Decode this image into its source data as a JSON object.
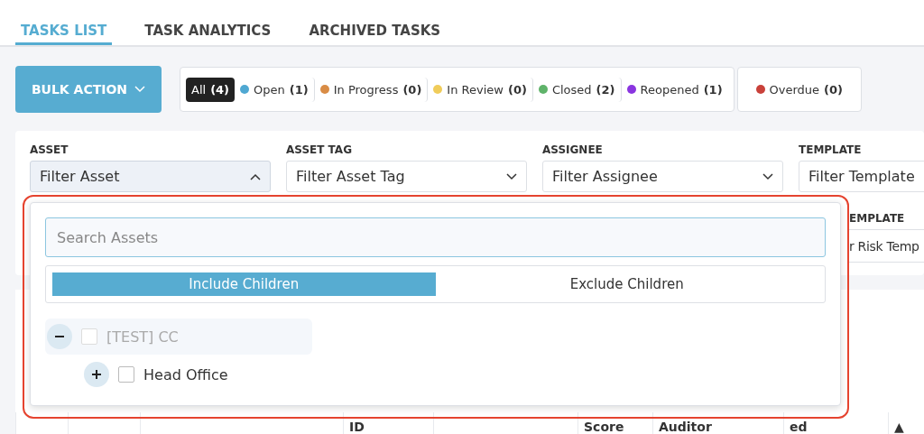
{
  "tabs": [
    {
      "label": "TASKS LIST",
      "selected": true
    },
    {
      "label": "TASK ANALYTICS",
      "selected": false
    },
    {
      "label": "ARCHIVED TASKS",
      "selected": false
    }
  ],
  "bulk_action": {
    "label": "BULK ACTION"
  },
  "status_filters": [
    {
      "label": "All",
      "count": "(4)",
      "selected": true
    },
    {
      "label": "Open",
      "count": "(1)",
      "color": "#4fa8d2",
      "selected": false
    },
    {
      "label": "In Progress",
      "count": "(0)",
      "color": "#d98c45",
      "selected": false
    },
    {
      "label": "In Review",
      "count": "(0)",
      "color": "#f0cc5a",
      "selected": false
    },
    {
      "label": "Closed",
      "count": "(2)",
      "color": "#5fb36a",
      "selected": false
    },
    {
      "label": "Reopened",
      "count": "(1)",
      "color": "#8a35e0",
      "selected": false
    }
  ],
  "overdue_filter": {
    "label": "Overdue",
    "count": "(0)",
    "color": "#c9413a",
    "selected": false
  },
  "filters": [
    {
      "label": "ASSET",
      "placeholder": "Filter Asset",
      "expanded": true
    },
    {
      "label": "ASSET TAG",
      "placeholder": "Filter Asset Tag",
      "expanded": false
    },
    {
      "label": "ASSIGNEE",
      "placeholder": "Filter Assignee",
      "expanded": false
    },
    {
      "label": "TEMPLATE",
      "placeholder": "Filter Template",
      "expanded": false
    }
  ],
  "second_row_filter": {
    "label": "EMPLATE",
    "value": "r Risk Temp"
  },
  "asset_dropdown": {
    "search": {
      "placeholder": "Search Assets"
    },
    "modes": [
      {
        "label": "Include Children",
        "selected": true
      },
      {
        "label": "Exclude Children",
        "selected": false
      }
    ],
    "tree": [
      {
        "label": "[TEST] CC",
        "expanded": true,
        "checked": false,
        "disabled": true,
        "children": [
          {
            "label": "Head Office",
            "expanded": false,
            "checked": false,
            "disabled": false
          }
        ]
      }
    ]
  },
  "table": {
    "columns": [
      "ID",
      "Score",
      "Auditor",
      "ed"
    ],
    "sort_indicator": "▲"
  }
}
